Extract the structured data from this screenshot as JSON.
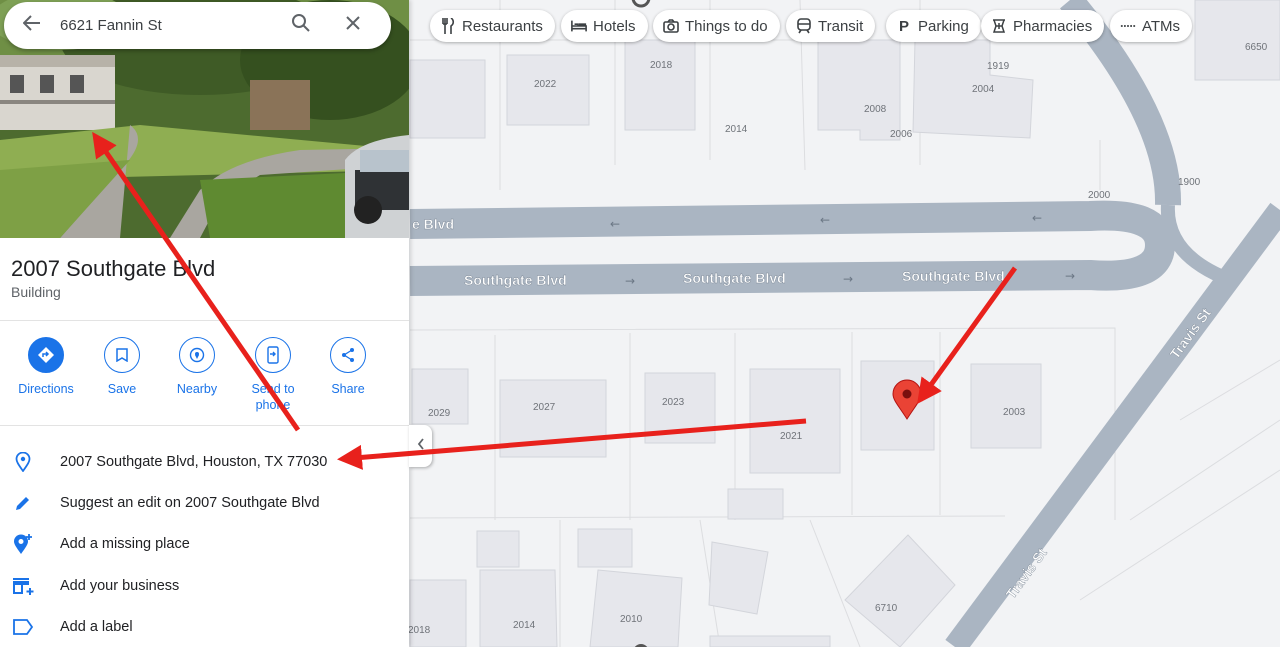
{
  "search": {
    "value": "6621 Fannin St"
  },
  "place": {
    "title": "2007 Southgate Blvd",
    "type": "Building"
  },
  "actions": [
    {
      "label": "Directions"
    },
    {
      "label": "Save"
    },
    {
      "label": "Nearby"
    },
    {
      "label": "Send to phone"
    },
    {
      "label": "Share"
    }
  ],
  "info_rows": [
    {
      "text": "2007 Southgate Blvd, Houston, TX 77030",
      "icon": "location-pin-icon"
    },
    {
      "text": "Suggest an edit on 2007 Southgate Blvd",
      "icon": "pencil-icon"
    },
    {
      "text": "Add a missing place",
      "icon": "add-location-icon"
    },
    {
      "text": "Add your business",
      "icon": "add-business-icon"
    },
    {
      "text": "Add a label",
      "icon": "label-icon"
    }
  ],
  "chips": [
    {
      "label": "Restaurants",
      "icon": "fork-knife-icon"
    },
    {
      "label": "Hotels",
      "icon": "bed-icon"
    },
    {
      "label": "Things to do",
      "icon": "camera-icon"
    },
    {
      "label": "Transit",
      "icon": "train-icon"
    },
    {
      "label": "Parking",
      "icon": "parking-icon"
    },
    {
      "label": "Pharmacies",
      "icon": "pharmacy-icon"
    },
    {
      "label": "ATMs",
      "icon": "atm-icon"
    }
  ],
  "map": {
    "streets": {
      "southgate_upper": "e Blvd",
      "southgate_lower": "Southgate Blvd",
      "travis": "Travis St"
    },
    "lot_numbers": [
      "2022",
      "2018",
      "1919",
      "2004",
      "2008",
      "2006",
      "2014",
      "6650",
      "2000",
      "1900",
      "2029",
      "2027",
      "2023",
      "2021",
      "2003",
      "6710",
      "2018",
      "2014",
      "2010"
    ]
  },
  "colors": {
    "accent": "#1a73e8",
    "annotation": "#e8211c",
    "road": "#aab5c2",
    "pin": "#ea4335"
  }
}
